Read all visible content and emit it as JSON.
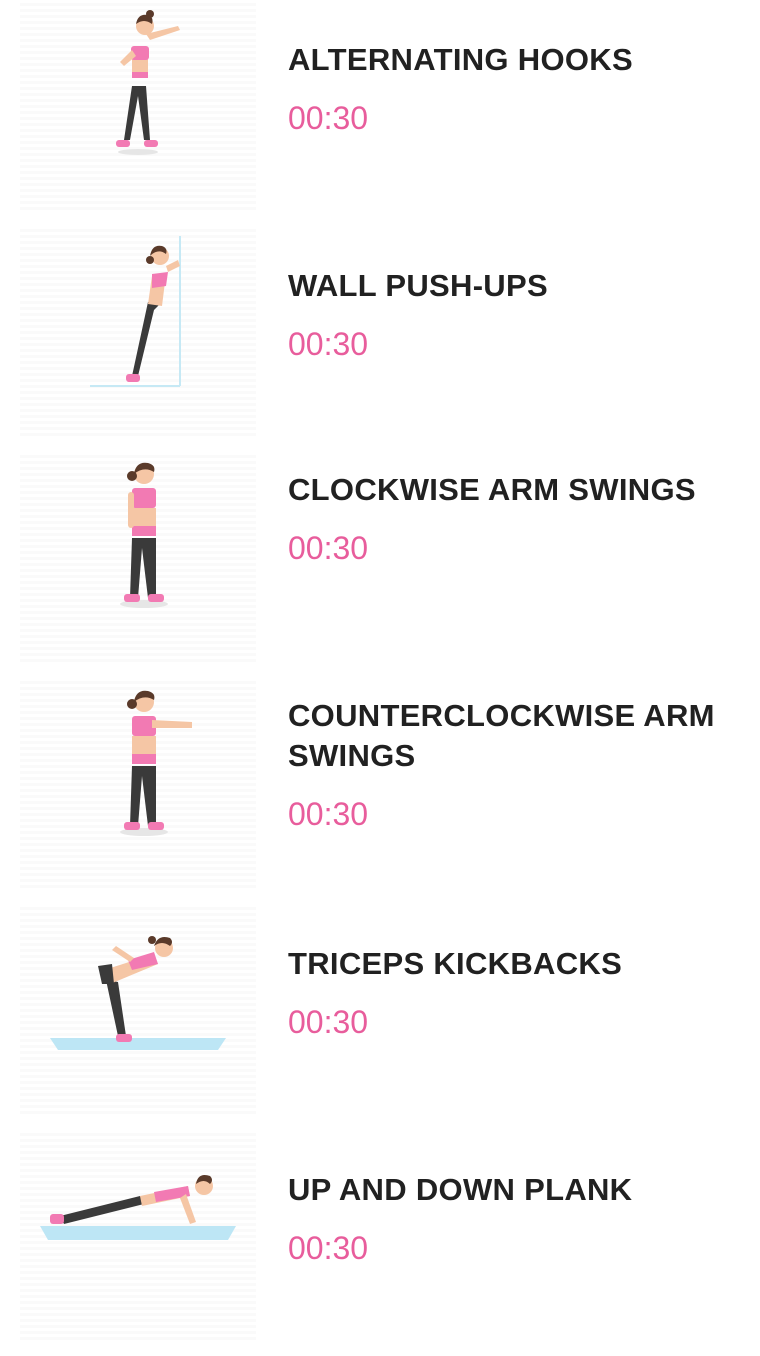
{
  "exercises": [
    {
      "name": "ALTERNATING HOOKS",
      "duration": "00:30",
      "pose": "standing-hook"
    },
    {
      "name": "WALL PUSH-UPS",
      "duration": "00:30",
      "pose": "wall-pushup"
    },
    {
      "name": "CLOCKWISE ARM SWINGS",
      "duration": "00:30",
      "pose": "standing"
    },
    {
      "name": "COUNTERCLOCKWISE ARM SWINGS",
      "duration": "00:30",
      "pose": "arm-forward"
    },
    {
      "name": "TRICEPS KICKBACKS",
      "duration": "00:30",
      "pose": "bent-over"
    },
    {
      "name": "UP AND DOWN PLANK",
      "duration": "00:30",
      "pose": "plank"
    }
  ],
  "colors": {
    "accent": "#e85d9c",
    "title": "#212121",
    "top": "#f27ab3",
    "legs": "#3a3a3a",
    "skin": "#f5c6a5",
    "hair": "#5a3a2a",
    "mat": "#bde6f5"
  }
}
